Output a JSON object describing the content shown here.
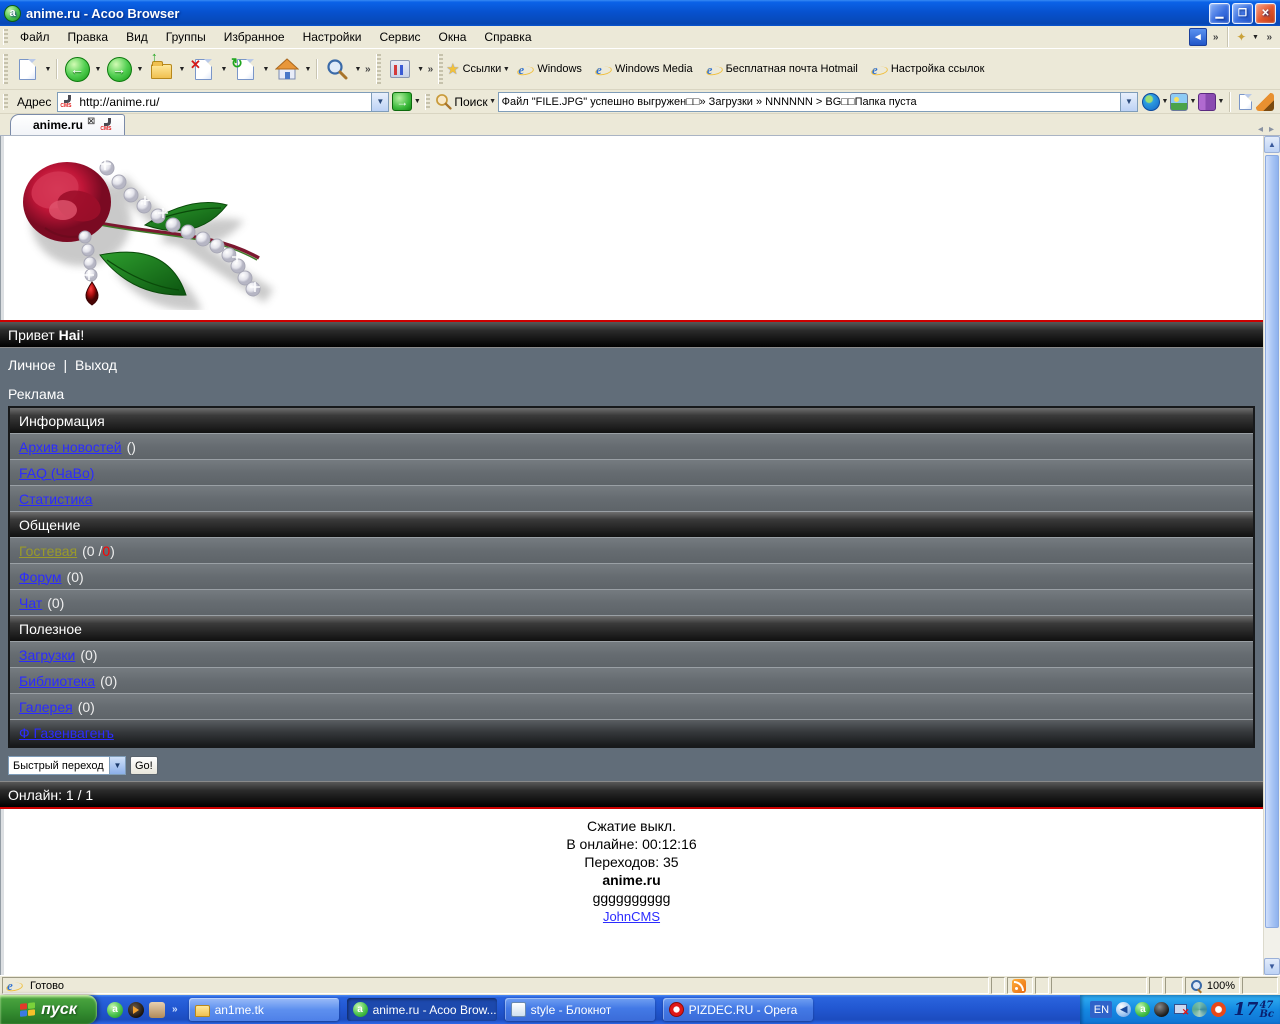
{
  "colors": {
    "accent_blue": "#0752cf",
    "link_blue": "#2b2bff",
    "visited_link_olive": "#9a9a2a",
    "counter_red": "#ff0000",
    "bar_line_red": "#cc0000",
    "slate_panel": "#616d79"
  },
  "titlebar": {
    "title": "anime.ru - Acoo Browser"
  },
  "menubar": {
    "items": [
      "Файл",
      "Правка",
      "Вид",
      "Группы",
      "Избранное",
      "Настройки",
      "Сервис",
      "Окна",
      "Справка"
    ]
  },
  "toolbar": {
    "icons": [
      "new-page",
      "back",
      "forward",
      "upload",
      "stop",
      "refresh",
      "home",
      "search",
      "tools"
    ]
  },
  "linksbar": {
    "label": "Ссылки",
    "links": [
      "Windows",
      "Windows Media",
      "Бесплатная почта Hotmail",
      "Настройка ссылок"
    ]
  },
  "addressbar": {
    "label": "Адрес",
    "url": "http://anime.ru/",
    "search_label": "Поиск",
    "search_text": "Файл \"FILE.JPG\" успешно выгружен□□» Загрузки » NNNNNN > BG□□Папка пуста"
  },
  "tabbar": {
    "active_tab": "anime.ru"
  },
  "page": {
    "greeting": {
      "prefix": "Привет ",
      "name": "Hai",
      "suffix": "!"
    },
    "usernav": {
      "personal": "Личное",
      "sep": "|",
      "logout": "Выход"
    },
    "ads_label": "Реклама",
    "sections": [
      {
        "header": "Информация",
        "items": [
          {
            "label": "Архив новостей",
            "suffix": "()"
          },
          {
            "label": "FAQ (ЧаВо)",
            "suffix": ""
          },
          {
            "label": "Статистика",
            "suffix": ""
          }
        ]
      },
      {
        "header": "Общение",
        "items": [
          {
            "label": "Гостевая",
            "suffix_pre": "(0 / ",
            "suffix_red": "0",
            "suffix_post": ")"
          },
          {
            "label": "Форум",
            "suffix": "(0)"
          },
          {
            "label": "Чат",
            "suffix": "(0)"
          }
        ]
      },
      {
        "header": "Полезное",
        "items": [
          {
            "label": "Загрузки",
            "suffix": "(0)"
          },
          {
            "label": "Библиотека",
            "suffix": "(0)"
          },
          {
            "label": "Галерея",
            "suffix": "(0)"
          },
          {
            "label": "Ф Газенвагенъ",
            "suffix": ""
          }
        ]
      }
    ],
    "quickjump": {
      "select": "Быстрый переход",
      "go": "Go!"
    },
    "online": "Онлайн: 1 / 1",
    "stats": {
      "line1": "Сжатие выкл.",
      "line2": "В онлайне: 00:12:16",
      "line3": "Переходов: 35",
      "site": "anime.ru",
      "note": "gggggggggg",
      "cms": "JohnCMS"
    }
  },
  "statusbar": {
    "status": "Готово",
    "zoom": "100%"
  },
  "taskbar": {
    "start": "пуск",
    "buttons": [
      {
        "label": "an1me.tk"
      },
      {
        "label": "anime.ru - Acoo Brow..."
      },
      {
        "label": "style - Блокнот"
      },
      {
        "label": "PIZDEC.RU - Opera"
      }
    ],
    "tray": {
      "lang": "EN",
      "clock_h": "17",
      "clock_m": "47",
      "clock_d": "Вс"
    }
  }
}
